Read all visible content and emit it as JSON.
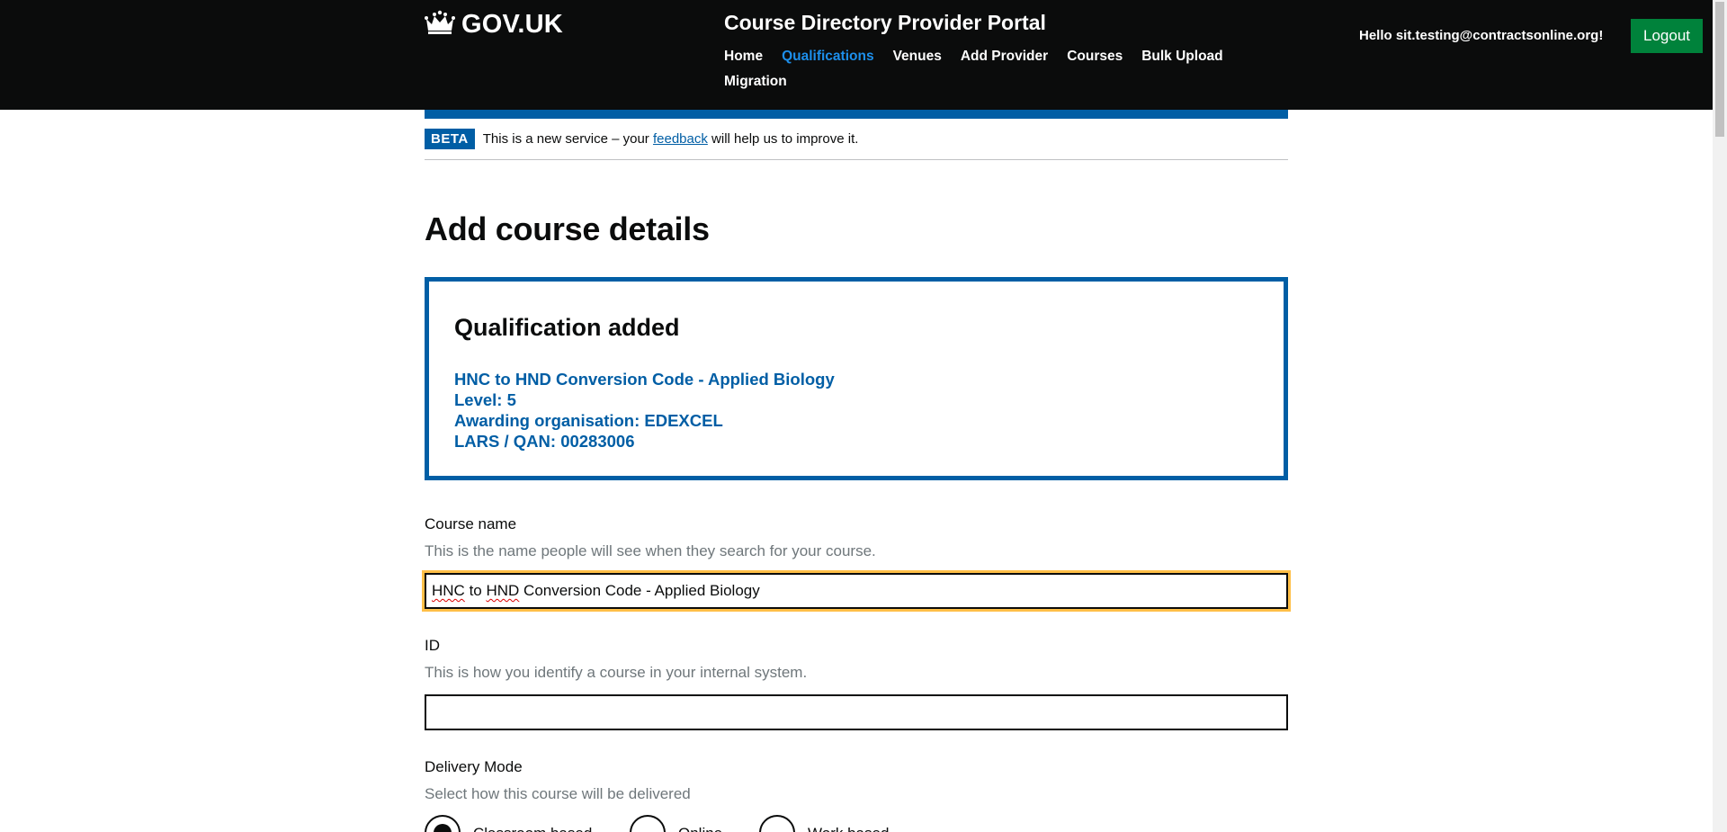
{
  "header": {
    "logo_text": "GOV.UK",
    "service_name": "Course Directory Provider Portal",
    "nav": [
      {
        "label": "Home"
      },
      {
        "label": "Qualifications"
      },
      {
        "label": "Venues"
      },
      {
        "label": "Add Provider"
      },
      {
        "label": "Courses"
      },
      {
        "label": "Bulk Upload"
      },
      {
        "label": "Migration"
      }
    ],
    "active_nav": "Qualifications",
    "greeting": "Hello sit.testing@contractsonline.org!",
    "logout_label": "Logout"
  },
  "beta": {
    "tag": "BETA",
    "text_before": "This is a new service – your ",
    "link": "feedback",
    "text_after": " will help us to improve it."
  },
  "page_title": "Add course details",
  "panel": {
    "title": "Qualification added",
    "name": "HNC to HND Conversion Code - Applied Biology",
    "level": "Level: 5",
    "awarding": "Awarding organisation: EDEXCEL",
    "lars": "LARS / QAN: 00283006"
  },
  "course_name": {
    "label": "Course name",
    "hint": "This is the name people will see when they search for your course.",
    "value_part1": "HNC",
    "value_part2": " to ",
    "value_part3": "HND",
    "value_part4": " Conversion Code - Applied Biology"
  },
  "id_field": {
    "label": "ID",
    "hint": "This is how you identify a course in your internal system.",
    "value": ""
  },
  "delivery_mode": {
    "label": "Delivery Mode",
    "hint": "Select how this course will be delivered",
    "options": [
      {
        "label": "Classroom based",
        "checked": true
      },
      {
        "label": "Online",
        "checked": false
      },
      {
        "label": "Work based",
        "checked": false
      }
    ]
  },
  "colors": {
    "header_bg": "#0b0c0c",
    "brand_blue": "#005ea5",
    "active_link": "#1d8feb",
    "logout_green": "#00823b",
    "focus_yellow": "#ffbf47"
  }
}
